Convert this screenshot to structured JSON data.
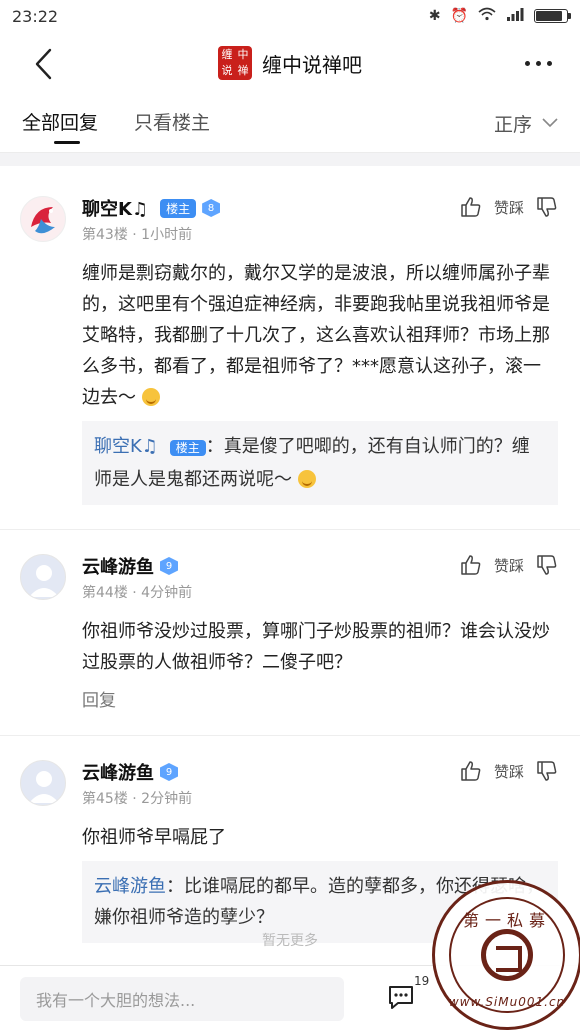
{
  "status": {
    "time": "23:22"
  },
  "nav": {
    "forum_title": "缠中说禅吧",
    "logo_text": [
      "缠",
      "中",
      "说",
      "禅"
    ]
  },
  "tabs": {
    "all_replies": "全部回复",
    "host_only": "只看楼主",
    "sort": "正序"
  },
  "actions": {
    "upvote": "赞踩"
  },
  "posts": [
    {
      "username": "聊空K♫",
      "host_badge": "楼主",
      "level": "8",
      "meta": "第43楼 · 1小时前",
      "body": "缠师是剽窃戴尔的，戴尔又学的是波浪，所以缠师属孙子辈的，这吧里有个强迫症神经病，非要跑我帖里说我祖师爷是艾略特，我都删了十几次了，这么喜欢认祖拜师？市场上那么多书，都看了，都是祖师爷了？***愿意认这孙子，滚一边去～",
      "quote_name": "聊空K♫",
      "quote_badge": "楼主",
      "quote_text": "：真是傻了吧唧的，还有自认师门的？缠师是人是鬼都还两说呢～"
    },
    {
      "username": "云峰游鱼",
      "level": "9",
      "meta": "第44楼 · 4分钟前",
      "body": "你祖师爷没炒过股票，算哪门子炒股票的祖师？谁会认没炒过股票的人做祖师爷？二傻子吧？",
      "reply_label": "回复"
    },
    {
      "username": "云峰游鱼",
      "level": "9",
      "meta": "第45楼 · 2分钟前",
      "body": "你祖师爷早嗝屁了",
      "quote_name": "云峰游鱼",
      "quote_text": "：比谁嗝屁的都早。造的孽都多，你还得瑟啥，嫌你祖师爷造的孽少？"
    }
  ],
  "footer": {
    "no_more": "暂无更多",
    "input_placeholder": "我有一个大胆的想法...",
    "comment_count": "19"
  },
  "watermark": {
    "title": "第一私募",
    "url": "www.SiMu001.cn"
  },
  "colors": {
    "accent": "#3d8ef3",
    "quote_name": "#3b6fb3",
    "logo_red": "#c9201b"
  }
}
